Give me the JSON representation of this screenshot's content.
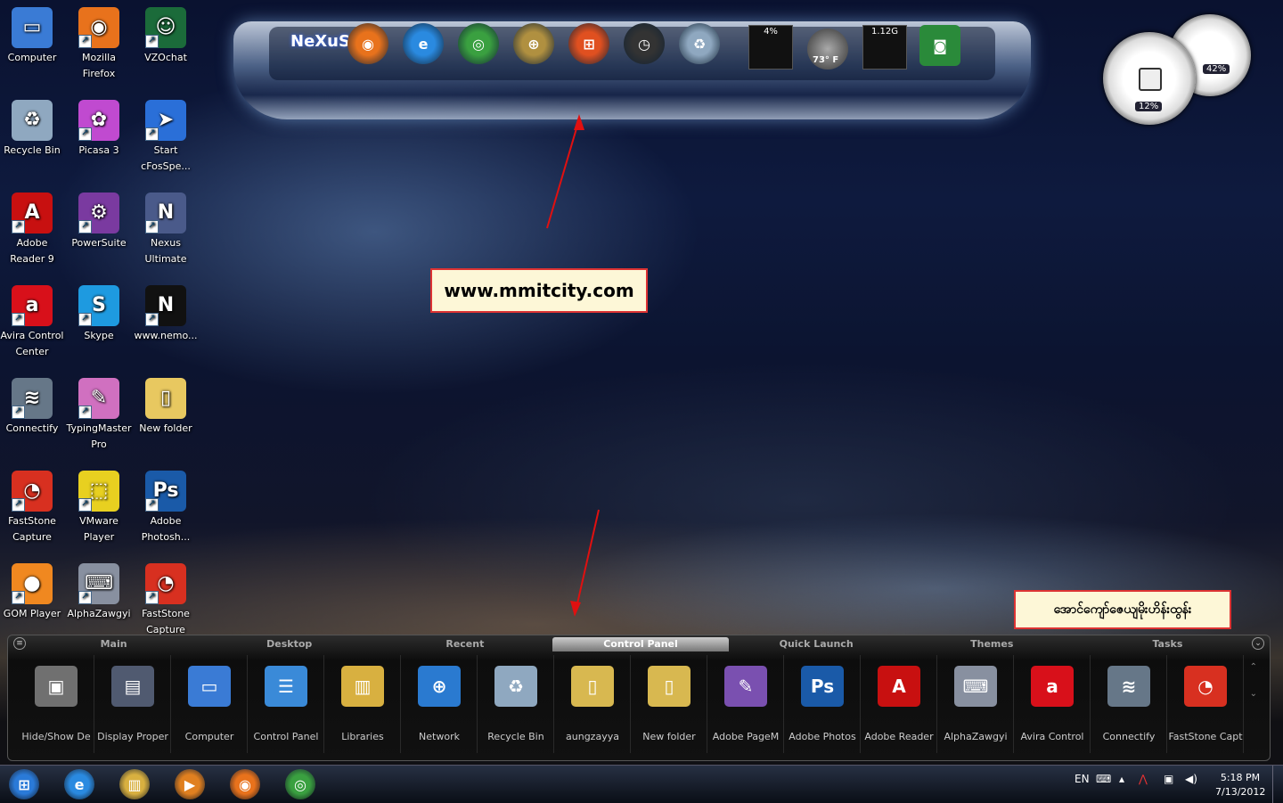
{
  "desktop_icons": [
    {
      "label": "Computer",
      "icon": "computer-icon",
      "color": "#3a7bd5",
      "glyph": "▭"
    },
    {
      "label": "Mozilla Firefox",
      "icon": "firefox-icon",
      "color": "#e8721c",
      "glyph": "◉"
    },
    {
      "label": "VZOchat",
      "icon": "vzochat-icon",
      "color": "#1b6b3a",
      "glyph": "☺"
    },
    {
      "label": "Recycle Bin",
      "icon": "recycle-bin-icon",
      "color": "#8fa8c0",
      "glyph": "♻"
    },
    {
      "label": "Picasa 3",
      "icon": "picasa-icon",
      "color": "#c04ad0",
      "glyph": "✿"
    },
    {
      "label": "Start cFosSpe...",
      "icon": "cfosspeed-icon",
      "color": "#2a6fd8",
      "glyph": "➤"
    },
    {
      "label": "Adobe Reader 9",
      "icon": "adobe-reader-icon",
      "color": "#c81010",
      "glyph": "A"
    },
    {
      "label": "PowerSuite",
      "icon": "powersuite-icon",
      "color": "#7a3aa0",
      "glyph": "⚙"
    },
    {
      "label": "Nexus Ultimate",
      "icon": "nexus-icon",
      "color": "#4a5a8a",
      "glyph": "N"
    },
    {
      "label": "Avira Control Center",
      "icon": "avira-icon",
      "color": "#d8101a",
      "glyph": "a"
    },
    {
      "label": "Skype",
      "icon": "skype-icon",
      "color": "#1e9ae0",
      "glyph": "S"
    },
    {
      "label": "www.nemo...",
      "icon": "nemo-icon",
      "color": "#111111",
      "glyph": "N"
    },
    {
      "label": "Connectify",
      "icon": "connectify-icon",
      "color": "#667788",
      "glyph": "≋"
    },
    {
      "label": "TypingMaster Pro",
      "icon": "typingmaster-icon",
      "color": "#d070c0",
      "glyph": "✎"
    },
    {
      "label": "New folder",
      "icon": "folder-icon",
      "color": "#e8c860",
      "glyph": "▯"
    },
    {
      "label": "FastStone Capture",
      "icon": "faststone-icon",
      "color": "#d83020",
      "glyph": "◔"
    },
    {
      "label": "VMware Player",
      "icon": "vmware-icon",
      "color": "#e8d020",
      "glyph": "⬚"
    },
    {
      "label": "Adobe Photosh...",
      "icon": "photoshop-icon",
      "color": "#1a5aa8",
      "glyph": "Ps"
    },
    {
      "label": "GOM Player",
      "icon": "gom-player-icon",
      "color": "#f08820",
      "glyph": "●"
    },
    {
      "label": "AlphaZawgyi",
      "icon": "keyboard-icon",
      "color": "#8890a0",
      "glyph": "⌨"
    },
    {
      "label": "FastStone Capture",
      "icon": "faststone-icon",
      "color": "#d83020",
      "glyph": "◔"
    }
  ],
  "top_dock": {
    "logo": "NeXuS",
    "items": [
      {
        "name": "firefox-icon",
        "color": "#e8721c",
        "glyph": "◉"
      },
      {
        "name": "internet-explorer-icon",
        "color": "#2a8ae0",
        "glyph": "e"
      },
      {
        "name": "chrome-icon",
        "color": "#3aa040",
        "glyph": "◎"
      },
      {
        "name": "globe-icon",
        "color": "#b09040",
        "glyph": "⊕"
      },
      {
        "name": "windows-icon",
        "color": "#e05020",
        "glyph": "⊞"
      },
      {
        "name": "clock-icon",
        "color": "#333333",
        "glyph": "◷"
      },
      {
        "name": "recycle-bin-icon",
        "color": "#8fa8c0",
        "glyph": "♻"
      }
    ],
    "cpu_meter": "4%",
    "weather_temp": "73° F",
    "memory_meter": "1.12G",
    "camera": {
      "name": "camera-icon",
      "color": "#2a8a3a",
      "glyph": "◙"
    }
  },
  "gauges": {
    "cpu": "12%",
    "memory": "42%"
  },
  "callouts": {
    "website": "www.mmitcity.com",
    "myanmar_text": "အောင်ကျော်ဇေယျမိုးဟိန်းထွန်း"
  },
  "bottom_dock": {
    "tabs": [
      "Main",
      "Desktop",
      "Recent",
      "Control Panel",
      "Quick Launch",
      "Themes",
      "Tasks"
    ],
    "active_tab": "Control Panel",
    "items": [
      {
        "label": "Hide/Show De",
        "icon": "desktop-toggle-icon",
        "color": "#707070",
        "glyph": "▣"
      },
      {
        "label": "Display Proper",
        "icon": "display-properties-icon",
        "color": "#505a70",
        "glyph": "▤"
      },
      {
        "label": "Computer",
        "icon": "computer-icon",
        "color": "#3a7bd5",
        "glyph": "▭"
      },
      {
        "label": "Control Panel",
        "icon": "control-panel-icon",
        "color": "#3a8ad8",
        "glyph": "☰"
      },
      {
        "label": "Libraries",
        "icon": "libraries-icon",
        "color": "#d8b040",
        "glyph": "▥"
      },
      {
        "label": "Network",
        "icon": "network-icon",
        "color": "#2a7ad0",
        "glyph": "⊕"
      },
      {
        "label": "Recycle Bin",
        "icon": "recycle-bin-icon",
        "color": "#8fa8c0",
        "glyph": "♻"
      },
      {
        "label": "aungzayya",
        "icon": "folder-icon",
        "color": "#d8b850",
        "glyph": "▯"
      },
      {
        "label": "New folder",
        "icon": "folder-icon",
        "color": "#d8b850",
        "glyph": "▯"
      },
      {
        "label": "Adobe PageM",
        "icon": "pagemaker-icon",
        "color": "#7a50b0",
        "glyph": "✎"
      },
      {
        "label": "Adobe Photos",
        "icon": "photoshop-icon",
        "color": "#1a5aa8",
        "glyph": "Ps"
      },
      {
        "label": "Adobe Reader",
        "icon": "adobe-reader-icon",
        "color": "#c81010",
        "glyph": "A"
      },
      {
        "label": "AlphaZawgyi",
        "icon": "keyboard-icon",
        "color": "#8890a0",
        "glyph": "⌨"
      },
      {
        "label": "Avira Control",
        "icon": "avira-icon",
        "color": "#d8101a",
        "glyph": "a"
      },
      {
        "label": "Connectify",
        "icon": "connectify-icon",
        "color": "#667788",
        "glyph": "≋"
      },
      {
        "label": "FastStone Capt",
        "icon": "faststone-icon",
        "color": "#d83020",
        "glyph": "◔"
      }
    ]
  },
  "taskbar": {
    "items": [
      {
        "name": "start-button-icon",
        "color": "#2a7ad8",
        "glyph": "⊞"
      },
      {
        "name": "internet-explorer-icon",
        "color": "#2a8ae0",
        "glyph": "e"
      },
      {
        "name": "explorer-icon",
        "color": "#d8b040",
        "glyph": "▥"
      },
      {
        "name": "media-player-icon",
        "color": "#e08020",
        "glyph": "▶"
      },
      {
        "name": "firefox-icon",
        "color": "#e8721c",
        "glyph": "◉"
      },
      {
        "name": "chrome-icon",
        "color": "#3aa040",
        "glyph": "◎"
      }
    ],
    "language": "EN",
    "time": "5:18 PM",
    "date": "7/13/2012"
  }
}
